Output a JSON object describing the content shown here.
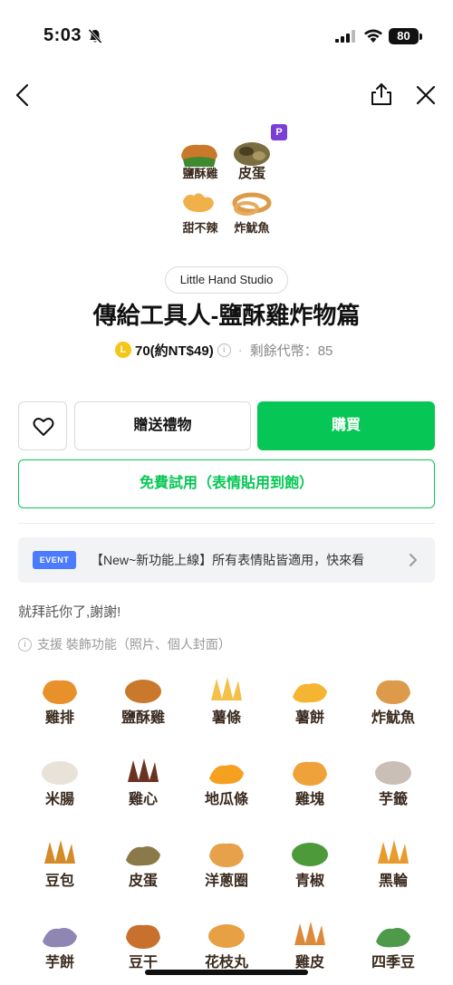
{
  "status_bar": {
    "time": "5:03",
    "battery": "80"
  },
  "nav": {
    "back": "back-icon",
    "share": "share-icon",
    "close": "close-icon"
  },
  "cover": {
    "badge": "P",
    "labels": [
      "鹽酥雞",
      "皮蛋",
      "甜不辣",
      "炸魷魚"
    ]
  },
  "product": {
    "author": "Little Hand Studio",
    "title": "傳給工具人-鹽酥雞炸物篇",
    "coin_symbol": "L",
    "price": "70(約NT$49)",
    "info_mark": "i",
    "coins_left": "剩餘代幣：85"
  },
  "actions": {
    "gift": "贈送禮物",
    "buy": "購買",
    "trial": "免費試用（表情貼用到飽）"
  },
  "event": {
    "badge": "EVENT",
    "text": "【New~新功能上線】所有表情貼皆適用，快來看"
  },
  "description": "就拜託你了,謝謝!",
  "support": {
    "text": "支援 裝飾功能（照片、個人封面）"
  },
  "stickers": [
    {
      "label": "雞排",
      "color": "#e8902a"
    },
    {
      "label": "鹽酥雞",
      "color": "#c9782c"
    },
    {
      "label": "薯條",
      "color": "#f4c04a"
    },
    {
      "label": "薯餅",
      "color": "#f5b431"
    },
    {
      "label": "炸魷魚",
      "color": "#dd9a4a"
    },
    {
      "label": "米腸",
      "color": "#e8e2d8"
    },
    {
      "label": "雞心",
      "color": "#6b3222"
    },
    {
      "label": "地瓜條",
      "color": "#f5a11f"
    },
    {
      "label": "雞塊",
      "color": "#f0a23a"
    },
    {
      "label": "芋籤",
      "color": "#c9bfb6"
    },
    {
      "label": "豆包",
      "color": "#d48a26"
    },
    {
      "label": "皮蛋",
      "color": "#8a7a4a"
    },
    {
      "label": "洋蔥圈",
      "color": "#e6a14a"
    },
    {
      "label": "青椒",
      "color": "#4c9a3a"
    },
    {
      "label": "黑輪",
      "color": "#e89a2a"
    },
    {
      "label": "芋餅",
      "color": "#8f86b3"
    },
    {
      "label": "豆干",
      "color": "#c8702e"
    },
    {
      "label": "花枝丸",
      "color": "#e7a043"
    },
    {
      "label": "雞皮",
      "color": "#dc8a3a"
    },
    {
      "label": "四季豆",
      "color": "#4e9a4a"
    }
  ],
  "colors": {
    "brand_green": "#06c755",
    "event_blue": "#4b7bff",
    "premium_purple": "#7b3fd6"
  }
}
